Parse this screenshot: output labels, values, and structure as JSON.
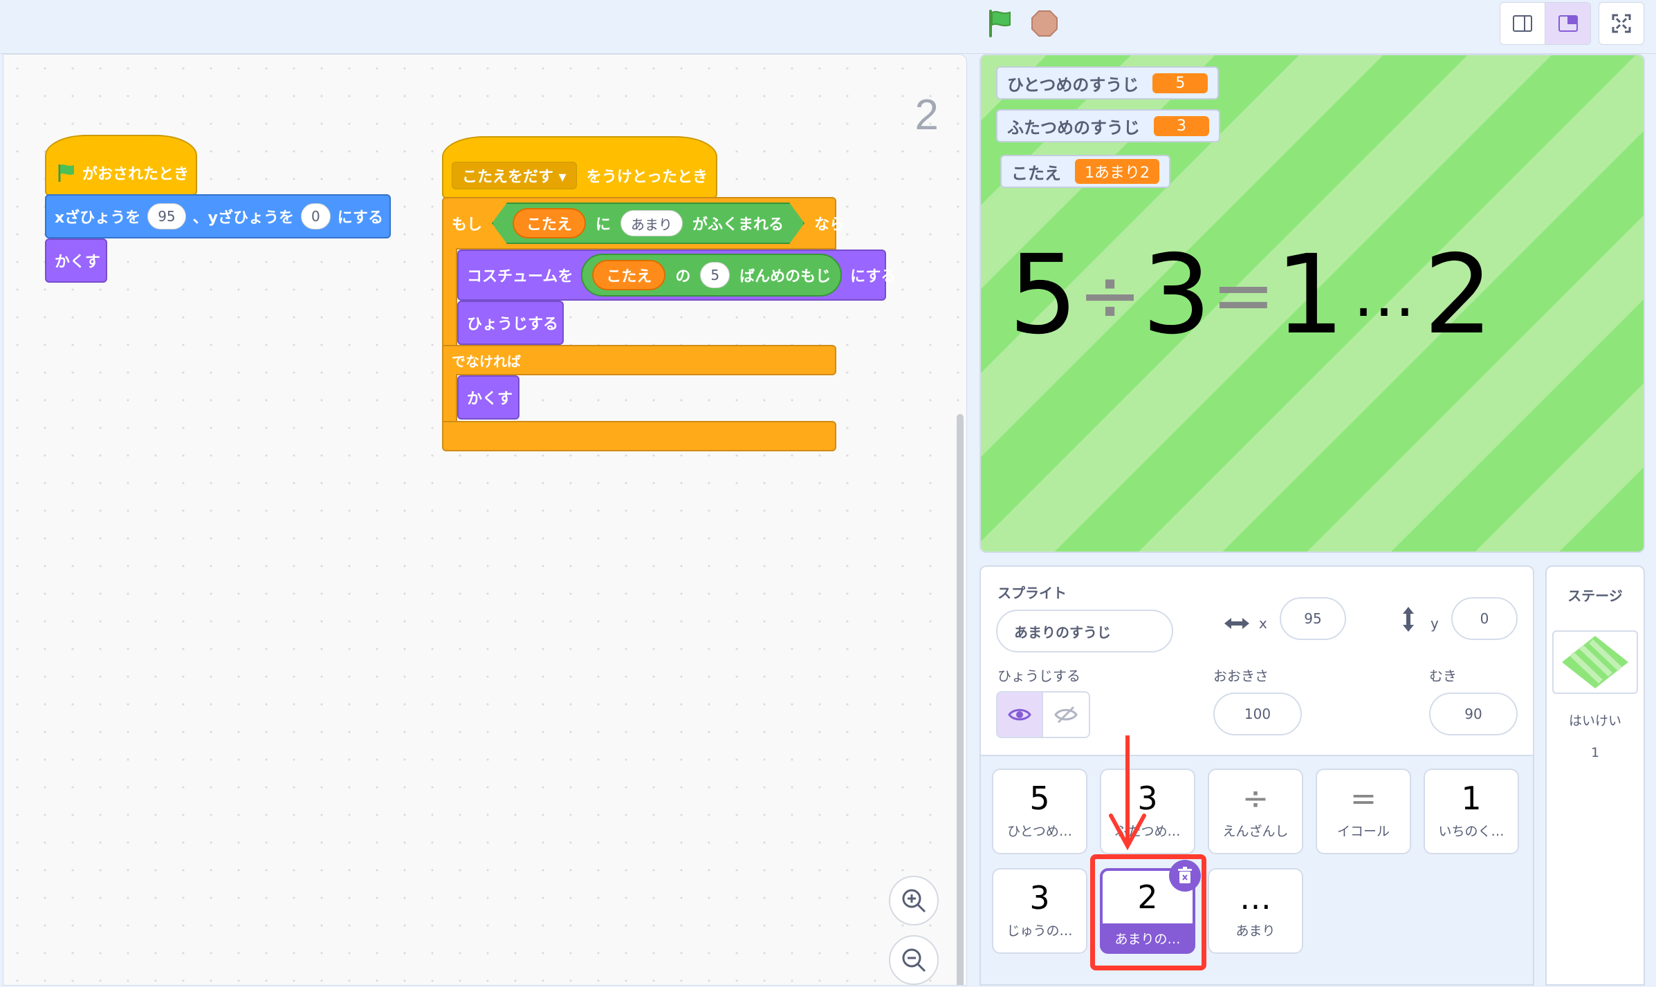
{
  "toolbar": {
    "green_flag_icon": "green-flag-icon",
    "stop_icon": "stop-icon",
    "colors": {
      "flag": "#4cbf56",
      "stop": "#d9a08a",
      "accent": "#855cd6"
    }
  },
  "code": {
    "sprite_number": "2",
    "script1": {
      "hat_label": "がおされたとき",
      "goto_label_1": "xざひょうを",
      "goto_x": "95",
      "goto_label_2": "、yざひょうを",
      "goto_y": "0",
      "goto_label_3": "にする",
      "hide_label": "かくす"
    },
    "script2": {
      "hat_dropdown": "こたえをだす ▾",
      "hat_label": "をうけとったとき",
      "if_label": "もし",
      "answer_reporter": "こたえ",
      "ni_label": "に",
      "contains_value": "あまり",
      "contains_label": "がふくまれる",
      "nara_label": "なら",
      "costume_label": "コスチュームを",
      "answer_reporter_2": "こたえ",
      "no_label": "の",
      "letter_index": "5",
      "letter_label": "ばんめのもじ",
      "set_label": "にする",
      "show_label": "ひょうじする",
      "else_label": "でなければ",
      "hide_label": "かくす"
    }
  },
  "stage": {
    "monitors": [
      {
        "label": "ひとつめのすうじ",
        "value": "5"
      },
      {
        "label": "ふたつめのすうじ",
        "value": "3"
      },
      {
        "label": "こたえ",
        "value": "1あまり2"
      }
    ],
    "display": [
      "5",
      "÷",
      "3",
      "=",
      "1",
      "…",
      "2"
    ]
  },
  "sprite_info": {
    "sprite_label": "スプライト",
    "sprite_name": "あまりのすうじ",
    "x_label": "x",
    "x_value": "95",
    "y_label": "y",
    "y_value": "0",
    "show_label": "ひょうじする",
    "size_label": "おおきさ",
    "size_value": "100",
    "direction_label": "むき",
    "direction_value": "90"
  },
  "sprites": [
    {
      "glyph": "5",
      "name": "ひとつめ…"
    },
    {
      "glyph": "3",
      "name": "ふたつめ…"
    },
    {
      "glyph": "÷",
      "name": "えんざんし"
    },
    {
      "glyph": "=",
      "name": "イコール"
    },
    {
      "glyph": "1",
      "name": "いちのく…"
    },
    {
      "glyph": "3",
      "name": "じゅうの…"
    },
    {
      "glyph": "2",
      "name": "あまりの…"
    },
    {
      "glyph": "…",
      "name": "あまり"
    }
  ],
  "stage_pane": {
    "title": "ステージ",
    "backdrop_label": "はいけい",
    "backdrop_count": "1"
  }
}
